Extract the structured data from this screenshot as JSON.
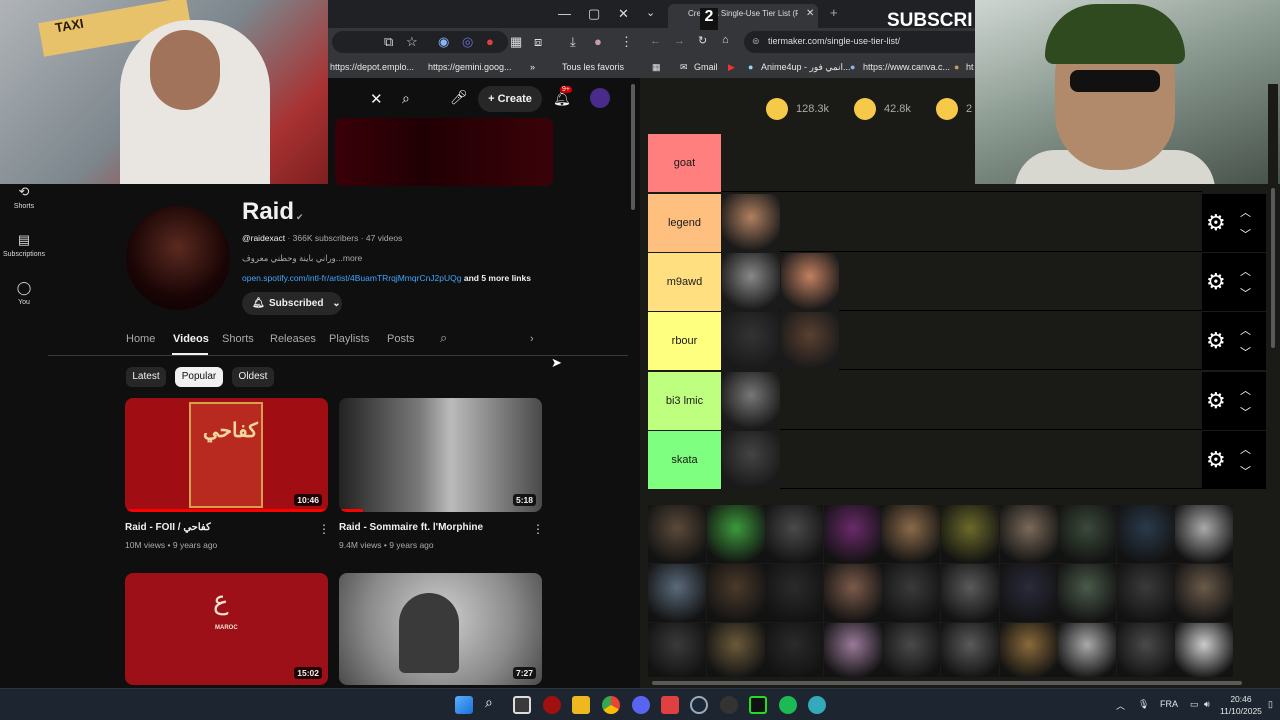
{
  "youtube": {
    "bookmarks": [
      "https://depot.emplo...",
      "https://gemini.goog...",
      "Tous les favoris"
    ],
    "header": {
      "create_label": "Create",
      "notif_count": "9+"
    },
    "sidebar": [
      {
        "label": "Shorts",
        "icon": "shorts-icon"
      },
      {
        "label": "Subscriptions",
        "icon": "subscriptions-icon"
      },
      {
        "label": "You",
        "icon": "you-icon"
      }
    ],
    "channel": {
      "name": "Raid",
      "handle": "@raidexact",
      "subs": " · 366K subscribers · 47 videos",
      "desc": "وراني باينة وحطني معروف...more",
      "link": "open.spotify.com/intl-fr/artist/4BuamTRrqjMmqrCnJ2pUQg",
      "more_links": " and 5 more links",
      "subscribed_label": "Subscribed"
    },
    "tabs": [
      "Home",
      "Videos",
      "Shorts",
      "Releases",
      "Playlists",
      "Posts"
    ],
    "active_tab": "Videos",
    "chips": [
      "Latest",
      "Popular",
      "Oldest"
    ],
    "selected_chip": "Popular",
    "videos": [
      {
        "title": "Raid - FOII / كفاحي",
        "meta": "10M views • 9 years ago",
        "duration": "10:46"
      },
      {
        "title": "Raid - Sommaire ft. l'Morphine",
        "meta": "9.4M views • 9 years ago",
        "duration": "5:18"
      },
      {
        "title": "",
        "meta": "",
        "duration": "15:02"
      },
      {
        "title": "",
        "meta": "",
        "duration": "7:27"
      }
    ]
  },
  "tiermaker": {
    "tab_title": "Create a Single-Use Tier List (P...",
    "url": "tiermaker.com/single-use-tier-list/",
    "bookmarks": [
      "Gmail",
      "Anime4up - انمي فور...",
      "https://www.canva.c...",
      "ht"
    ],
    "reactions": [
      {
        "count": "128.3k"
      },
      {
        "count": "42.8k"
      },
      {
        "count": "2"
      }
    ],
    "tiers": [
      {
        "label": "goat",
        "color": "#ff7f7f",
        "items": 0
      },
      {
        "label": "legend",
        "color": "#ffbf7f",
        "items": 1
      },
      {
        "label": "m9awd",
        "color": "#ffdf7f",
        "items": 2
      },
      {
        "label": "rbour",
        "color": "#ffff7f",
        "items": 2
      },
      {
        "label": "bi3 lmic",
        "color": "#bfff7f",
        "items": 1
      },
      {
        "label": "skata",
        "color": "#7fff7f",
        "items": 1
      }
    ],
    "overlay_text": "SUBSCRI",
    "overlay_num": "2"
  },
  "taskbar": {
    "lang": "FRA",
    "time": "20:46",
    "date": "11/10/2025"
  }
}
